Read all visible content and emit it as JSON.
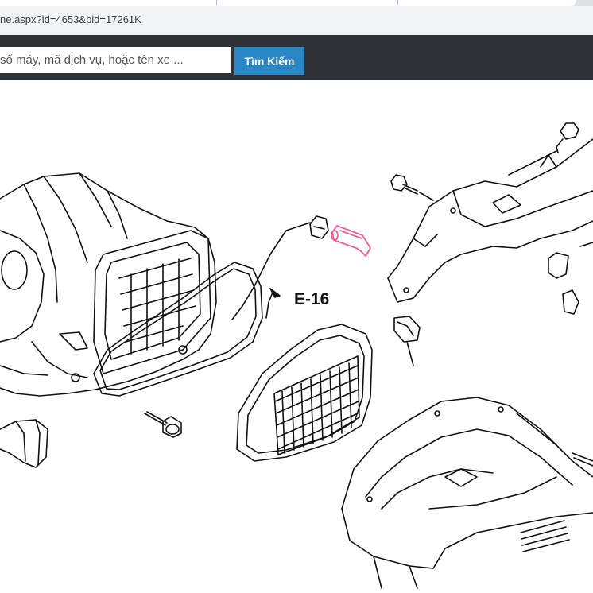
{
  "browser": {
    "url": "ne.aspx?id=4653&pid=17261K"
  },
  "search": {
    "placeholder": "số máy, mã dịch vụ, hoặc tên xe ...",
    "button_label": "Tìm Kiếm",
    "button_color": "#2b86c5",
    "header_color": "#2f3337"
  },
  "diagram": {
    "reference_label": "E-16",
    "highlight_color": "#e8609a"
  }
}
